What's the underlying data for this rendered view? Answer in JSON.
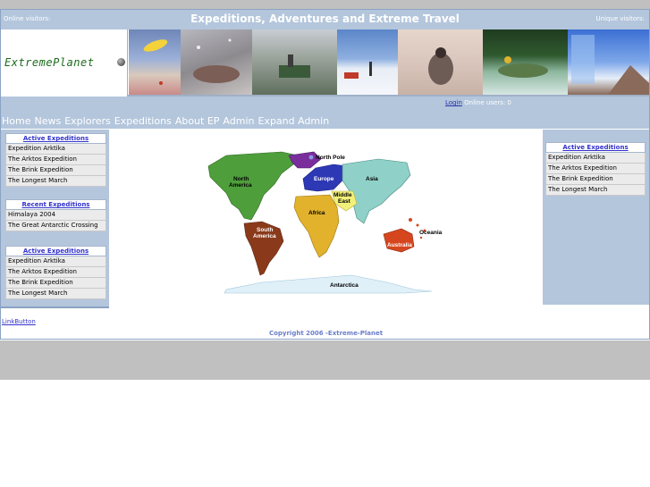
{
  "header": {
    "online_visitors": "Online visitors:",
    "title": "Expeditions, Adventures and Extreme Travel",
    "unique_visitors": "Unique visitors:"
  },
  "logo": {
    "text": "ExtremePlanet"
  },
  "nav": {
    "login": "Login",
    "online_users": "Online users: 0",
    "menu": [
      "Home",
      "News",
      "Explorers",
      "Expeditions",
      "About EP",
      "Admin",
      "Expand Admin"
    ]
  },
  "left": {
    "active1": {
      "title": "Active Expeditions",
      "items": [
        "Expedition Arktika",
        "The Arktos Expedition",
        "The Brink Expedition",
        "The Longest March"
      ]
    },
    "recent": {
      "title": "Recent Expeditions",
      "items": [
        "Himalaya 2004",
        "The Great Antarctic Crossing"
      ]
    },
    "active2": {
      "title": "Active Expeditions",
      "items": [
        "Expedition Arktika",
        "The Arktos Expedition",
        "The Brink Expedition",
        "The Longest March"
      ]
    }
  },
  "right": {
    "active": {
      "title": "Active Expeditions",
      "items": [
        "Expedition Arktika",
        "The Arktos Expedition",
        "The Brink Expedition",
        "The Longest March"
      ]
    }
  },
  "map": {
    "labels": {
      "north_pole": "North Pole",
      "north": "North",
      "america": "America",
      "europe": "Europe",
      "asia": "Asia",
      "middle": "Middle",
      "east": "East",
      "africa": "Africa",
      "south": "South",
      "south_america": "America",
      "oceania": "Oceania",
      "australia": "Australia",
      "antarctica": "Antarctica"
    },
    "colors": {
      "north_america": "#4f9e3c",
      "south_america": "#8a3a1a",
      "europe": "#2d38b4",
      "asia": "#8fd0c8",
      "middle_east": "#f2f07a",
      "africa": "#e2b22c",
      "australia": "#d6461e",
      "oceania": "#d6461e",
      "antarctica": "#dff0f8",
      "north_pole": "#8a9ae0",
      "greenland": "#7a2e9c"
    }
  },
  "footer": {
    "linkbutton": "LinkButton",
    "copyright": "Copyright 2006 -Extreme-Planet"
  }
}
